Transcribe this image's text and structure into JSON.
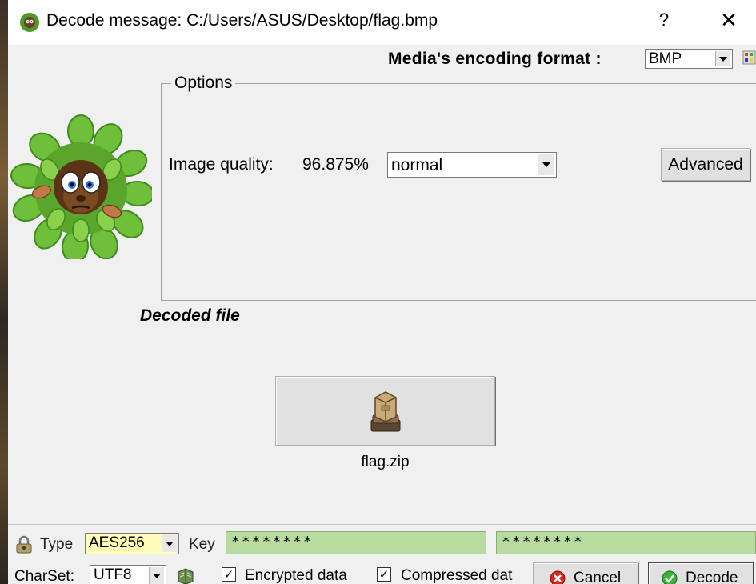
{
  "window": {
    "title": "Decode message: C:/Users/ASUS/Desktop/flag.bmp",
    "help_label": "?",
    "close_label": "✕"
  },
  "format": {
    "label": "Media's encoding format :",
    "value": "BMP"
  },
  "options": {
    "legend": "Options",
    "quality_label": "Image quality:",
    "quality_value": "96.875%",
    "quality_level": "normal",
    "advanced_label": "Advanced"
  },
  "decoded": {
    "title": "Decoded file",
    "file_name": "flag.zip"
  },
  "encryption": {
    "type_label": "Type",
    "type_value": "AES256",
    "key_label": "Key",
    "key_value": "********",
    "key_confirm_value": "********"
  },
  "footer": {
    "charset_label": "CharSet:",
    "charset_value": "UTF8",
    "encrypted_label": "Encrypted data",
    "encrypted_checked": "✓",
    "compressed_label": "Compressed dat",
    "compressed_checked": "✓",
    "cancel_label": "Cancel",
    "decode_label": "Decode"
  },
  "icons": {
    "app": "mascot-bush-icon",
    "palette": "palette-icon",
    "archive": "box-archive-icon",
    "lock": "lock-icon",
    "charset": "book-icon",
    "cancel": "red-x-icon",
    "decode": "green-check-icon"
  },
  "colors": {
    "key_field": "#b8dca0",
    "type_field": "#fefcb8",
    "window_bg": "#f0f0f0"
  }
}
